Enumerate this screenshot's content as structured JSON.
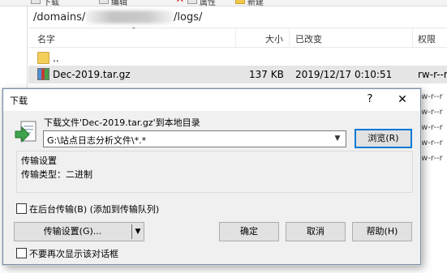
{
  "toolbar": {
    "items": [
      {
        "label": "下载",
        "icon": "document-icon"
      },
      {
        "label": "编辑",
        "icon": "edit-icon"
      },
      {
        "label": "属性",
        "icon": "properties-icon"
      },
      {
        "label": "新建",
        "icon": "new-folder-icon"
      }
    ]
  },
  "path_bar": {
    "prefix": "/domains/",
    "suffix": "/logs/"
  },
  "file_list": {
    "columns": {
      "name": "名字",
      "size": "大小",
      "modified": "已改变",
      "perms": "权限"
    },
    "rows": [
      {
        "name": "..",
        "size": "",
        "modified": "",
        "perms": "",
        "icon": "parent-folder-icon"
      },
      {
        "name": "Dec-2019.tar.gz",
        "size": "137 KB",
        "modified": "2019/12/17 0:10:51",
        "perms": "rw-r--r",
        "icon": "archive-icon",
        "selected": true
      }
    ],
    "hidden_rows_perms": [
      "rw-r--r",
      "rw-r--r",
      "rw-r--r",
      "rw-r--r",
      "rw-r--r"
    ]
  },
  "dialog": {
    "title": "下载",
    "help_glyph": "?",
    "close_glyph": "✕",
    "message": "下载文件'Dec-2019.tar.gz'到本地目录",
    "destination": "G:\\站点日志分析文件\\*.*",
    "browse_label": "浏览(R)",
    "group_title": "传输设置",
    "transfer_type": "传输类型：二进制",
    "background_checkbox": "在后台传输(B) (添加到传输队列)",
    "settings_label": "传输设置(G)...",
    "ok_label": "确定",
    "cancel_label": "取消",
    "help_label": "帮助(H)",
    "dont_show_checkbox": "不要再次显示该对话框"
  }
}
